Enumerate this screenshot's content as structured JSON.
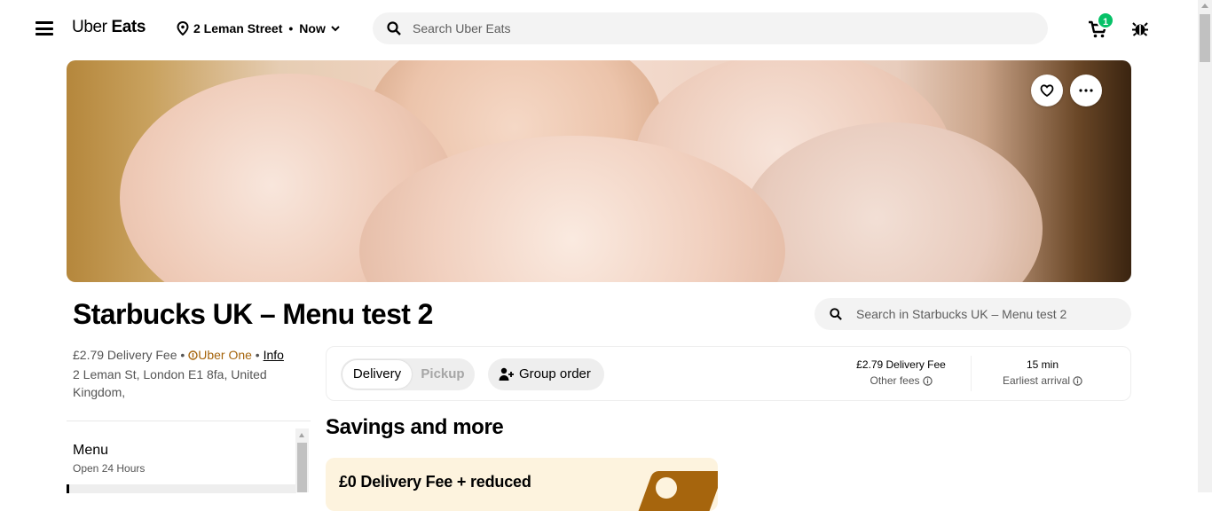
{
  "header": {
    "logo_part1": "Uber",
    "logo_part2": "Eats",
    "location": "2 Leman Street",
    "location_separator": "•",
    "time": "Now",
    "search_placeholder": "Search Uber Eats",
    "cart_count": "1"
  },
  "store": {
    "name": "Starbucks UK – Menu test 2",
    "search_placeholder": "Search in Starbucks UK – Menu test 2",
    "delivery_fee_text": "£2.79 Delivery Fee",
    "bullet": "•",
    "uber_one_label": "Uber One",
    "info_link": "Info",
    "address": "2 Leman St, London E1 8fa, United Kingdom,"
  },
  "order_options": {
    "delivery_label": "Delivery",
    "pickup_label": "Pickup",
    "selected": "Delivery",
    "group_order_label": "Group order",
    "fee_main": "£2.79 Delivery Fee",
    "fee_sub": "Other fees",
    "eta_main": "15 min",
    "eta_sub": "Earliest arrival"
  },
  "menu_nav": {
    "title": "Menu",
    "subtitle": "Open 24 Hours"
  },
  "savings": {
    "heading": "Savings and more",
    "promo_text": "£0 Delivery Fee + reduced"
  },
  "colors": {
    "accent_green": "#06c167",
    "uber_one_gold": "#a6650d",
    "promo_bg": "#fdf3de"
  }
}
